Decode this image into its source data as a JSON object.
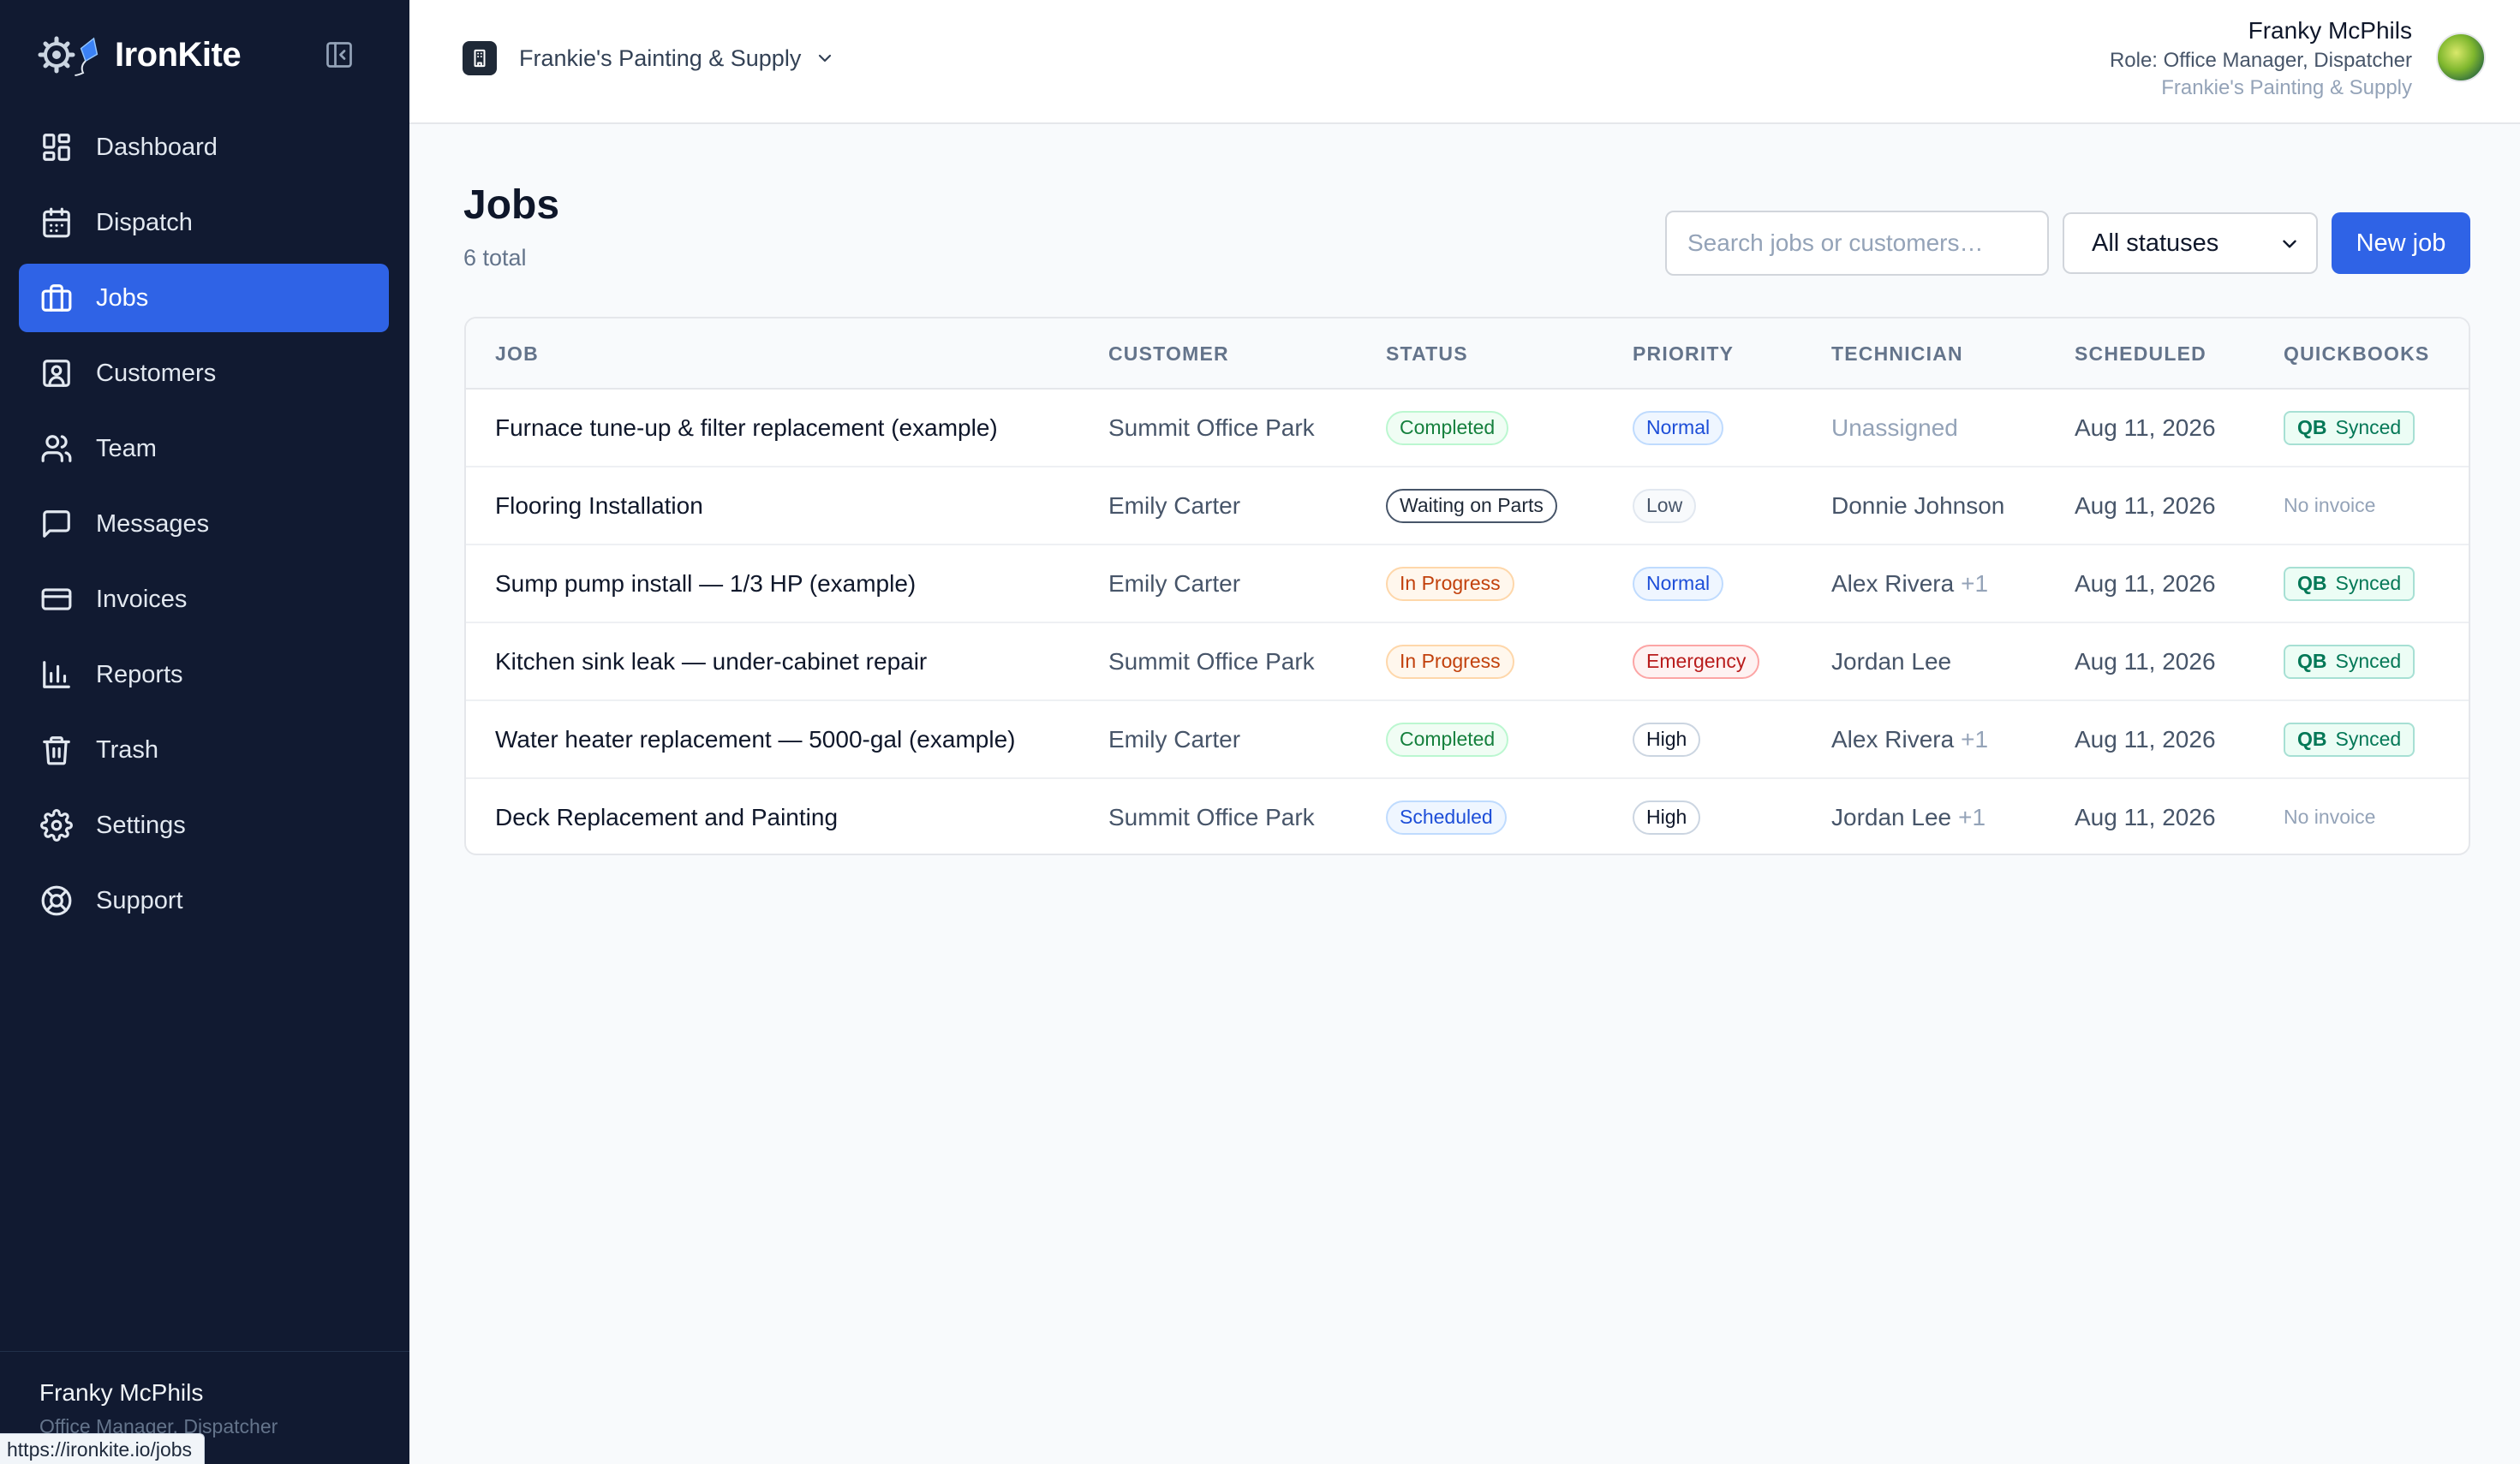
{
  "app": {
    "name": "IronKite"
  },
  "sidebar": {
    "items": [
      {
        "label": "Dashboard",
        "icon": "dashboard-icon"
      },
      {
        "label": "Dispatch",
        "icon": "calendar-icon"
      },
      {
        "label": "Jobs",
        "icon": "briefcase-icon",
        "active": true
      },
      {
        "label": "Customers",
        "icon": "contact-icon"
      },
      {
        "label": "Team",
        "icon": "users-icon"
      },
      {
        "label": "Messages",
        "icon": "message-icon"
      },
      {
        "label": "Invoices",
        "icon": "credit-card-icon"
      },
      {
        "label": "Reports",
        "icon": "bar-chart-icon"
      },
      {
        "label": "Trash",
        "icon": "trash-icon"
      },
      {
        "label": "Settings",
        "icon": "gear-icon"
      },
      {
        "label": "Support",
        "icon": "lifebuoy-icon"
      }
    ],
    "footer": {
      "user_name": "Franky McPhils",
      "user_role": "Office Manager, Dispatcher"
    }
  },
  "status_bar": {
    "url": "https://ironkite.io/jobs"
  },
  "header": {
    "org_name": "Frankie's Painting & Supply",
    "user_name": "Franky McPhils",
    "user_role": "Role: Office Manager, Dispatcher",
    "user_org": "Frankie's Painting & Supply"
  },
  "main": {
    "title": "Jobs",
    "count": "6 total",
    "search_placeholder": "Search jobs or customers…",
    "status_filter": "All statuses",
    "new_job_label": "New job",
    "columns": [
      "JOB",
      "CUSTOMER",
      "STATUS",
      "PRIORITY",
      "TECHNICIAN",
      "SCHEDULED",
      "QUICKBOOKS"
    ],
    "rows": [
      {
        "job": "Furnace tune-up & filter replacement (example)",
        "customer": "Summit Office Park",
        "status": "Completed",
        "priority": "Normal",
        "technician": "Unassigned",
        "tech_extra": "",
        "scheduled": "Aug 11, 2026",
        "qb_prefix": "QB",
        "qb": "Synced"
      },
      {
        "job": "Flooring Installation",
        "customer": "Emily Carter",
        "status": "Waiting on Parts",
        "priority": "Low",
        "technician": "Donnie Johnson",
        "tech_extra": "",
        "scheduled": "Aug 11, 2026",
        "qb_prefix": "",
        "qb": "No invoice"
      },
      {
        "job": "Sump pump install — 1/3 HP (example)",
        "customer": "Emily Carter",
        "status": "In Progress",
        "priority": "Normal",
        "technician": "Alex Rivera",
        "tech_extra": "+1",
        "scheduled": "Aug 11, 2026",
        "qb_prefix": "QB",
        "qb": "Synced"
      },
      {
        "job": "Kitchen sink leak — under-cabinet repair",
        "customer": "Summit Office Park",
        "status": "In Progress",
        "priority": "Emergency",
        "technician": "Jordan Lee",
        "tech_extra": "",
        "scheduled": "Aug 11, 2026",
        "qb_prefix": "QB",
        "qb": "Synced"
      },
      {
        "job": "Water heater replacement — 5000-gal (example)",
        "customer": "Emily Carter",
        "status": "Completed",
        "priority": "High",
        "technician": "Alex Rivera",
        "tech_extra": "+1",
        "scheduled": "Aug 11, 2026",
        "qb_prefix": "QB",
        "qb": "Synced"
      },
      {
        "job": "Deck Replacement and Painting",
        "customer": "Summit Office Park",
        "status": "Scheduled",
        "priority": "High",
        "technician": "Jordan Lee",
        "tech_extra": "+1",
        "scheduled": "Aug 11, 2026",
        "qb_prefix": "",
        "qb": "No invoice"
      }
    ]
  },
  "colors": {
    "sidebar_bg": "#111a31",
    "accent": "#2f63e6",
    "completed": "#15803d",
    "in_progress": "#c2410c",
    "emergency": "#b91c1c"
  }
}
